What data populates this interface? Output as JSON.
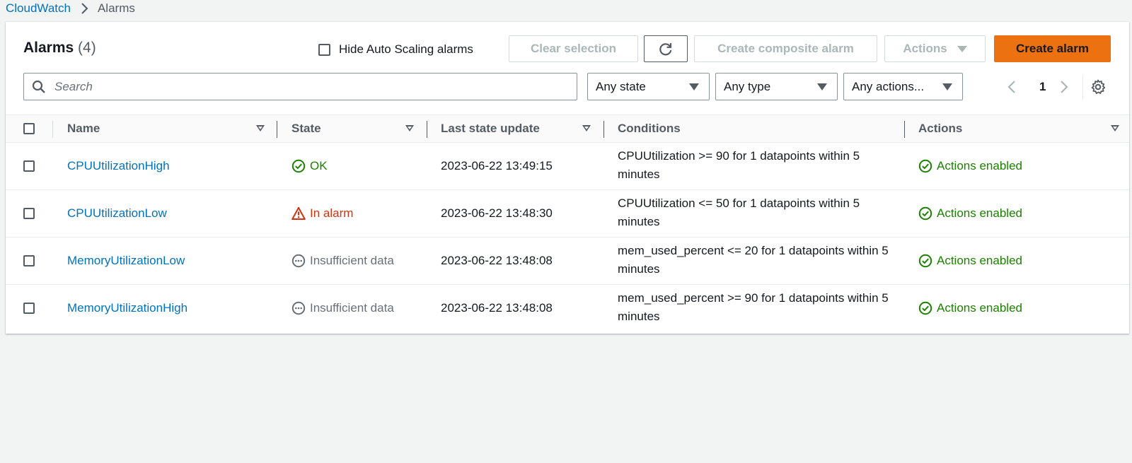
{
  "breadcrumb": {
    "root": "CloudWatch",
    "current": "Alarms"
  },
  "panel": {
    "title": "Alarms",
    "count": "(4)",
    "hide_autoscaling_label": "Hide Auto Scaling alarms",
    "buttons": {
      "clear_selection": "Clear selection",
      "create_composite": "Create composite alarm",
      "actions": "Actions",
      "create_alarm": "Create alarm"
    }
  },
  "filters": {
    "search_placeholder": "Search",
    "state": "Any state",
    "type": "Any type",
    "actions": "Any actions..."
  },
  "pagination": {
    "page": "1"
  },
  "table": {
    "headers": {
      "name": "Name",
      "state": "State",
      "last_update": "Last state update",
      "conditions": "Conditions",
      "actions": "Actions"
    },
    "rows": [
      {
        "name": "CPUUtilizationHigh",
        "state": "OK",
        "state_kind": "ok",
        "last_update": "2023-06-22 13:49:15",
        "conditions": "CPUUtilization >= 90 for 1 datapoints within 5 minutes",
        "actions": "Actions enabled"
      },
      {
        "name": "CPUUtilizationLow",
        "state": "In alarm",
        "state_kind": "alarm",
        "last_update": "2023-06-22 13:48:30",
        "conditions": "CPUUtilization <= 50 for 1 datapoints within 5 minutes",
        "actions": "Actions enabled"
      },
      {
        "name": "MemoryUtilizationLow",
        "state": "Insufficient data",
        "state_kind": "insufficient",
        "last_update": "2023-06-22 13:48:08",
        "conditions": "mem_used_percent <= 20 for 1 datapoints within 5 minutes",
        "actions": "Actions enabled"
      },
      {
        "name": "MemoryUtilizationHigh",
        "state": "Insufficient data",
        "state_kind": "insufficient",
        "last_update": "2023-06-22 13:48:08",
        "conditions": "mem_used_percent >= 90 for 1 datapoints within 5 minutes",
        "actions": "Actions enabled"
      }
    ]
  },
  "colors": {
    "link": "#0073bb",
    "ok": "#1d8102",
    "alarm": "#d13212",
    "insufficient": "#687078",
    "primary_button": "#ec7211"
  },
  "icons": {
    "ok": "status-ok-icon",
    "alarm": "warning-triangle-icon",
    "insufficient": "ellipsis-circle-icon",
    "actions_enabled": "check-circle-icon"
  }
}
